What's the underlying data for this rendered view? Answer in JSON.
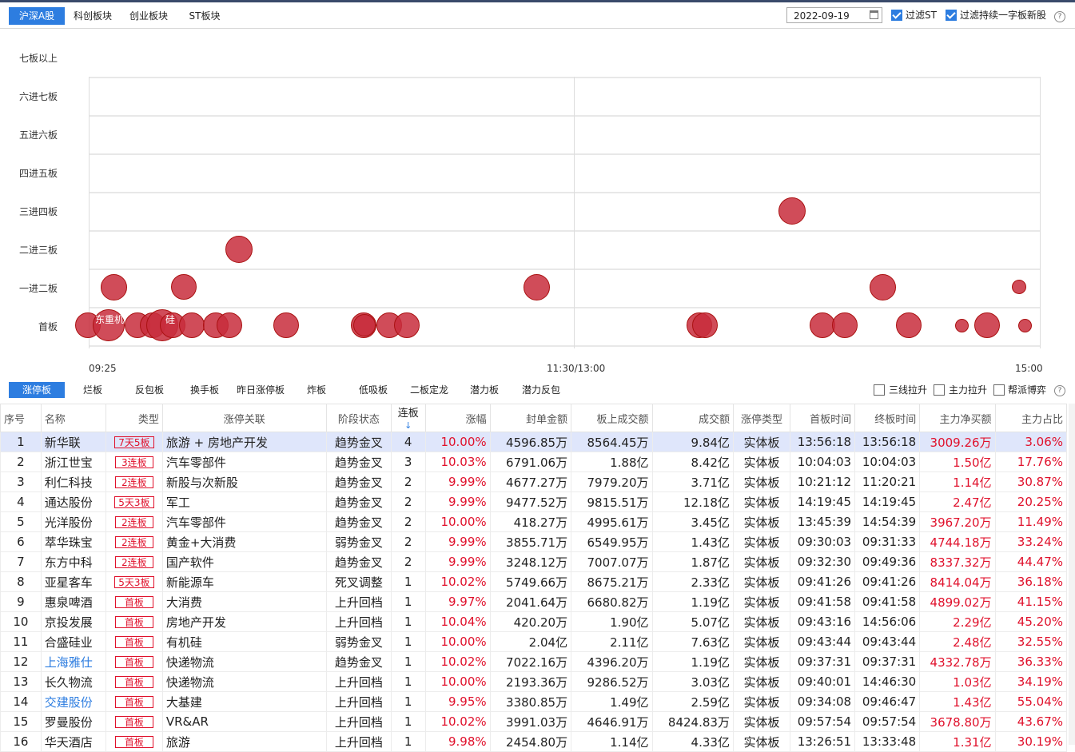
{
  "top_tabs": [
    "沪深A股",
    "科创板块",
    "创业板块",
    "ST板块"
  ],
  "date": "2022-09-19",
  "filters": [
    {
      "label": "过滤ST",
      "checked": true
    },
    {
      "label": "过滤持续一字板新股",
      "checked": true
    }
  ],
  "help_glyph": "?",
  "chart": {
    "y_levels": [
      "七板以上",
      "六进七板",
      "五进六板",
      "四进五板",
      "三进四板",
      "二进三板",
      "一进二板",
      "首板"
    ],
    "x_ticks": [
      "09:25",
      "11:30/13:00",
      "15:00"
    ],
    "bubble_labels": [
      "东重机",
      "硅"
    ]
  },
  "sub_tabs": [
    "涨停板",
    "烂板",
    "反包板",
    "换手板",
    "昨日涨停板",
    "炸板",
    "低吸板",
    "二板定龙",
    "潜力板",
    "潜力反包"
  ],
  "toggles": [
    "三线拉升",
    "主力拉升",
    "帮派博弈"
  ],
  "table": {
    "headers": [
      "序号",
      "名称",
      "类型",
      "涨停关联",
      "阶段状态",
      "连板",
      "涨幅",
      "封单金额",
      "板上成交额",
      "成交额",
      "涨停类型",
      "首板时间",
      "终板时间",
      "主力净买额",
      "主力占比"
    ],
    "sort_indicator": "↓",
    "rows": [
      [
        "1",
        "新华联",
        "7天5板",
        "旅游 + 房地产开发",
        "趋势金叉",
        "4",
        "10.00%",
        "4596.85万",
        "8564.45万",
        "9.84亿",
        "实体板",
        "13:56:18",
        "13:56:18",
        "3009.26万",
        "3.06%"
      ],
      [
        "2",
        "浙江世宝",
        "3连板",
        "汽车零部件",
        "趋势金叉",
        "3",
        "10.03%",
        "6791.06万",
        "1.88亿",
        "8.42亿",
        "实体板",
        "10:04:03",
        "10:04:03",
        "1.50亿",
        "17.76%"
      ],
      [
        "3",
        "利仁科技",
        "2连板",
        "新股与次新股",
        "趋势金叉",
        "2",
        "9.99%",
        "4677.27万",
        "7979.20万",
        "3.71亿",
        "实体板",
        "10:21:12",
        "11:20:21",
        "1.14亿",
        "30.87%"
      ],
      [
        "4",
        "通达股份",
        "5天3板",
        "军工",
        "趋势金叉",
        "2",
        "9.99%",
        "9477.52万",
        "9815.51万",
        "12.18亿",
        "实体板",
        "14:19:45",
        "14:19:45",
        "2.47亿",
        "20.25%"
      ],
      [
        "5",
        "光洋股份",
        "2连板",
        "汽车零部件",
        "趋势金叉",
        "2",
        "10.00%",
        "418.27万",
        "4995.61万",
        "3.45亿",
        "实体板",
        "13:45:39",
        "14:54:39",
        "3967.20万",
        "11.49%"
      ],
      [
        "6",
        "萃华珠宝",
        "2连板",
        "黄金+大消费",
        "弱势金叉",
        "2",
        "9.99%",
        "3855.71万",
        "6549.95万",
        "1.43亿",
        "实体板",
        "09:30:03",
        "09:31:33",
        "4744.18万",
        "33.24%"
      ],
      [
        "7",
        "东方中科",
        "2连板",
        "国产软件",
        "趋势金叉",
        "2",
        "9.99%",
        "3248.12万",
        "7007.07万",
        "1.87亿",
        "实体板",
        "09:32:30",
        "09:49:36",
        "8337.32万",
        "44.47%"
      ],
      [
        "8",
        "亚星客车",
        "5天3板",
        "新能源车",
        "死叉调整",
        "1",
        "10.02%",
        "5749.66万",
        "8675.21万",
        "2.33亿",
        "实体板",
        "09:41:26",
        "09:41:26",
        "8414.04万",
        "36.18%"
      ],
      [
        "9",
        "惠泉啤酒",
        "首板",
        "大消费",
        "上升回档",
        "1",
        "9.97%",
        "2041.64万",
        "6680.82万",
        "1.19亿",
        "实体板",
        "09:41:58",
        "09:41:58",
        "4899.02万",
        "41.15%"
      ],
      [
        "10",
        "京投发展",
        "首板",
        "房地产开发",
        "上升回档",
        "1",
        "10.04%",
        "420.20万",
        "1.90亿",
        "5.07亿",
        "实体板",
        "09:43:16",
        "14:56:06",
        "2.29亿",
        "45.20%"
      ],
      [
        "11",
        "合盛硅业",
        "首板",
        "有机硅",
        "弱势金叉",
        "1",
        "10.00%",
        "2.04亿",
        "2.11亿",
        "7.63亿",
        "实体板",
        "09:43:44",
        "09:43:44",
        "2.48亿",
        "32.55%"
      ],
      [
        "12",
        "上海雅仕",
        "首板",
        "快递物流",
        "趋势金叉",
        "1",
        "10.02%",
        "7022.16万",
        "4396.20万",
        "1.19亿",
        "实体板",
        "09:37:31",
        "09:37:31",
        "4332.78万",
        "36.33%"
      ],
      [
        "13",
        "长久物流",
        "首板",
        "快递物流",
        "上升回档",
        "1",
        "10.00%",
        "2193.36万",
        "9286.52万",
        "3.03亿",
        "实体板",
        "09:40:01",
        "14:46:30",
        "1.03亿",
        "34.19%"
      ],
      [
        "14",
        "交建股份",
        "首板",
        "大基建",
        "上升回档",
        "1",
        "9.95%",
        "3380.85万",
        "1.49亿",
        "2.59亿",
        "实体板",
        "09:34:08",
        "09:46:47",
        "1.43亿",
        "55.04%"
      ],
      [
        "15",
        "罗曼股份",
        "首板",
        "VR&AR",
        "上升回档",
        "1",
        "10.02%",
        "3991.03万",
        "4646.91万",
        "8424.83万",
        "实体板",
        "09:57:54",
        "09:57:54",
        "3678.80万",
        "43.67%"
      ],
      [
        "16",
        "华天酒店",
        "首板",
        "旅游",
        "上升回档",
        "1",
        "9.98%",
        "2454.80万",
        "1.14亿",
        "4.33亿",
        "实体板",
        "13:26:51",
        "13:33:48",
        "1.31亿",
        "30.19%"
      ]
    ],
    "blue_names": [
      "上海雅仕",
      "交建股份"
    ]
  }
}
